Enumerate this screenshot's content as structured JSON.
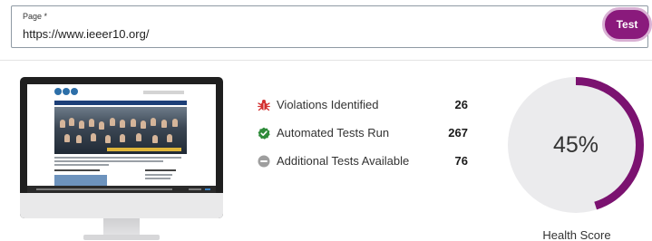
{
  "page_field": {
    "label": "Page *",
    "value": "https://www.ieeer10.org/"
  },
  "test_button": {
    "label": "Test"
  },
  "stats": [
    {
      "icon": "bug-icon",
      "label": "Violations Identified",
      "value": "26",
      "color": "#d32f2f"
    },
    {
      "icon": "check-circle-icon",
      "label": "Automated Tests Run",
      "value": "267",
      "color": "#2e8b3a"
    },
    {
      "icon": "minus-circle-icon",
      "label": "Additional Tests Available",
      "value": "76",
      "color": "#9e9e9e"
    }
  ],
  "health": {
    "percent": 45,
    "display": "45%",
    "caption": "Health Score",
    "progress_color": "#7b1270",
    "track_color": "#ebebed"
  },
  "colors": {
    "accent": "#8a1a7c"
  }
}
